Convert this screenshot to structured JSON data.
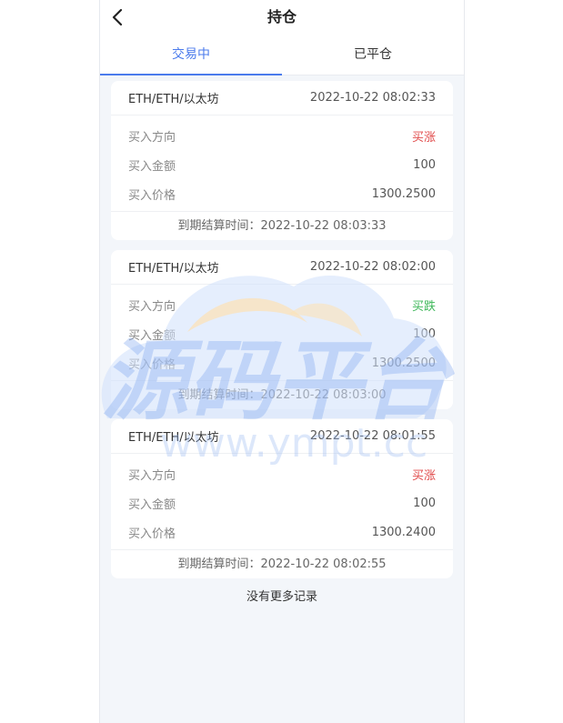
{
  "header": {
    "title": "持仓",
    "back_icon": "chevron-left-icon"
  },
  "tabs": [
    {
      "label": "交易中",
      "active": true
    },
    {
      "label": "已平仓",
      "active": false
    }
  ],
  "orders": [
    {
      "pair": "ETH/ETH/以太坊",
      "time": "2022-10-22 08:02:33",
      "rows": [
        {
          "label": "买入方向",
          "value": "买涨"
        },
        {
          "label": "买入金额",
          "value": "100"
        },
        {
          "label": "买入价格",
          "value": "1300.2500"
        }
      ],
      "expiry_label": "到期结算时间：",
      "expiry": "2022-10-22 08:03:33"
    },
    {
      "pair": "ETH/ETH/以太坊",
      "time": "2022-10-22 08:02:00",
      "rows": [
        {
          "label": "买入方向",
          "value": "买跌"
        },
        {
          "label": "买入金额",
          "value": "100"
        },
        {
          "label": "买入价格",
          "value": "1300.2500"
        }
      ],
      "expiry_label": "到期结算时间：",
      "expiry": "2022-10-22 08:03:00"
    },
    {
      "pair": "ETH/ETH/以太坊",
      "time": "2022-10-22 08:01:55",
      "rows": [
        {
          "label": "买入方向",
          "value": "买涨"
        },
        {
          "label": "买入金额",
          "value": "100"
        },
        {
          "label": "买入价格",
          "value": "1300.2400"
        }
      ],
      "expiry_label": "到期结算时间：",
      "expiry": "2022-10-22 08:02:55"
    }
  ],
  "footer": {
    "no_more": "没有更多记录"
  },
  "watermark": {
    "text": "源码平台",
    "url": "www.ympt.cc"
  },
  "colors": {
    "accent": "#4b7bec",
    "up": "#e14b4b",
    "down": "#3fb85a",
    "background": "#f3f6fa"
  }
}
